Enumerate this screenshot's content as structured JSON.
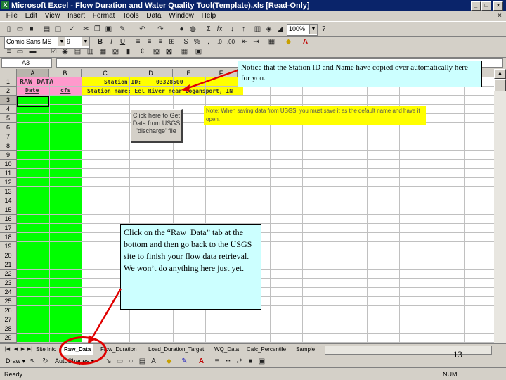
{
  "window": {
    "title": "Microsoft Excel - Flow Duration and Water Quality Tool(Template).xls [Read-Only]",
    "app_icon": "excel-icon"
  },
  "menu": {
    "items": [
      "File",
      "Edit",
      "View",
      "Insert",
      "Format",
      "Tools",
      "Data",
      "Window",
      "Help"
    ]
  },
  "toolbar": {
    "zoom": "100%",
    "font_name": "Comic Sans MS",
    "font_size": "9",
    "bold": "B",
    "italic": "I",
    "underline": "U",
    "percent": "%",
    "comma": ",",
    "sum": "Σ",
    "fx": "fx"
  },
  "formula_bar": {
    "name_box": "A3",
    "formula": ""
  },
  "columns": [
    "A",
    "B",
    "C",
    "D",
    "E",
    "F"
  ],
  "rows": [
    "1",
    "2",
    "3",
    "4",
    "5",
    "6",
    "7",
    "8",
    "9",
    "10",
    "11",
    "12",
    "13",
    "14",
    "15",
    "16",
    "17",
    "18",
    "19",
    "20",
    "21",
    "22",
    "23",
    "24",
    "25",
    "26",
    "27",
    "28",
    "29"
  ],
  "cells": {
    "a1": "RAW DATA",
    "a2": "Date",
    "b2": "cfs",
    "c1_label": "Station ID:",
    "c1_value": "03328500",
    "c2": "Station name:  Eel River near Logansport, IN"
  },
  "sheet_button": "Click here to Get Data from USGS 'discharge' file",
  "note": "Note:  When saving data from USGS, you must save it as the default name and have it open.",
  "callout_top": "Notice that the Station ID and Name have copied over automatically here for you.",
  "callout_bottom": "Click on the “Raw_Data” tab at the bottom and then go back to the USGS site to finish your flow data retrieval.  We won’t do anything here just yet.",
  "tabs": [
    "Site Info",
    "Raw_Data",
    "Flow_Duration",
    "Load_Duration_Target",
    "WQ_Data",
    "Calc_Percentile",
    "Sample"
  ],
  "active_tab": "Raw_Data",
  "draw_bar": {
    "draw": "Draw ▾",
    "autoshapes": "AutoShapes ▾"
  },
  "status": {
    "left": "Ready",
    "right": "NUM"
  },
  "slide_number": "13",
  "colors": {
    "green": "#00ff00",
    "pink": "#ff99cc",
    "yellow": "#ffff00",
    "callout": "#ccffff",
    "red": "#e00000"
  }
}
